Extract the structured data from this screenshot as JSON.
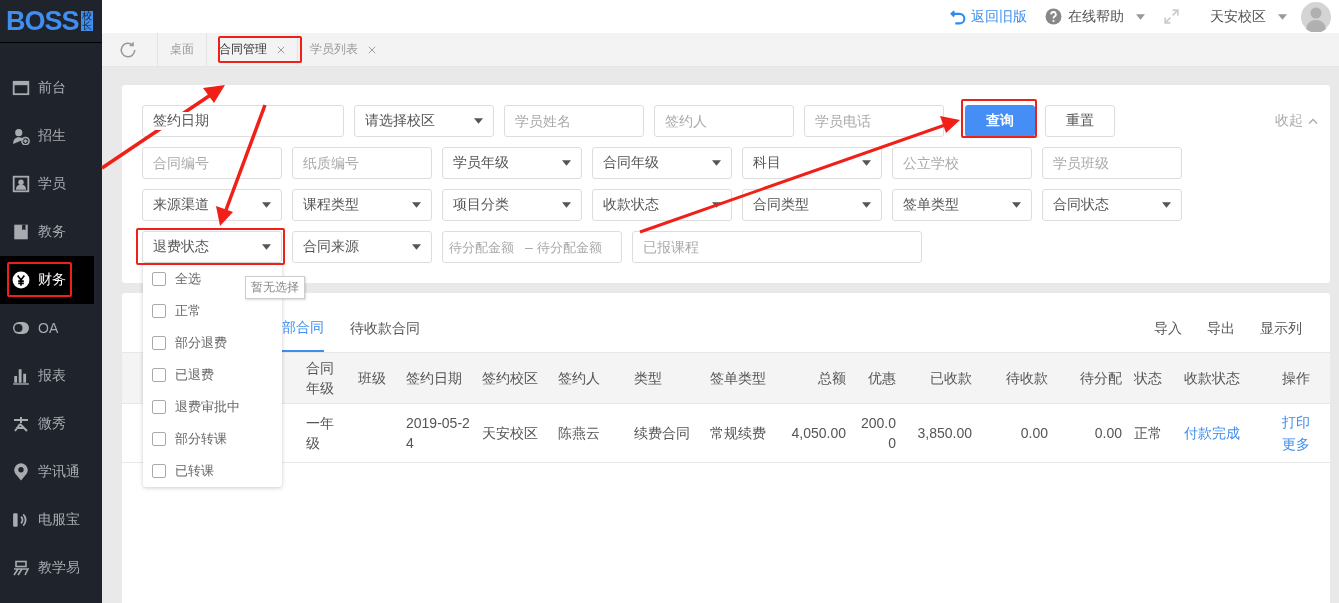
{
  "logo": {
    "text": "BOSS",
    "badge": "校长"
  },
  "header": {
    "back_link": "返回旧版",
    "help": "在线帮助",
    "campus": "天安校区"
  },
  "tabs": [
    {
      "label": "桌面",
      "closable": false,
      "selected": false
    },
    {
      "label": "合同管理",
      "closable": true,
      "selected": true
    },
    {
      "label": "学员列表",
      "closable": true,
      "selected": false
    }
  ],
  "sidebar": {
    "items": [
      {
        "label": "前台",
        "selected": false
      },
      {
        "label": "招生",
        "selected": false
      },
      {
        "label": "学员",
        "selected": false
      },
      {
        "label": "教务",
        "selected": false
      },
      {
        "label": "财务",
        "selected": true
      },
      {
        "label": "OA",
        "selected": false
      },
      {
        "label": "报表",
        "selected": false
      },
      {
        "label": "微秀",
        "selected": false
      },
      {
        "label": "学讯通",
        "selected": false
      },
      {
        "label": "电服宝",
        "selected": false
      },
      {
        "label": "教学易",
        "selected": false
      }
    ]
  },
  "filters": {
    "rows": [
      [
        {
          "kind": "date",
          "label": "签约日期"
        },
        {
          "kind": "select",
          "label": "请选择校区"
        },
        {
          "kind": "input",
          "placeholder": "学员姓名"
        },
        {
          "kind": "input",
          "placeholder": "签约人"
        },
        {
          "kind": "input",
          "placeholder": "学员电话"
        }
      ],
      [
        {
          "kind": "input",
          "placeholder": "合同编号"
        },
        {
          "kind": "input",
          "placeholder": "纸质编号"
        },
        {
          "kind": "select",
          "label": "学员年级"
        },
        {
          "kind": "select",
          "label": "合同年级"
        },
        {
          "kind": "select",
          "label": "科目"
        },
        {
          "kind": "input",
          "placeholder": "公立学校"
        },
        {
          "kind": "input",
          "placeholder": "学员班级"
        }
      ],
      [
        {
          "kind": "select",
          "label": "来源渠道"
        },
        {
          "kind": "select",
          "label": "课程类型"
        },
        {
          "kind": "select",
          "label": "项目分类"
        },
        {
          "kind": "select",
          "label": "收款状态"
        },
        {
          "kind": "select",
          "label": "合同类型"
        },
        {
          "kind": "select",
          "label": "签单类型"
        },
        {
          "kind": "select",
          "label": "合同状态"
        }
      ],
      [
        {
          "kind": "select",
          "label": "退费状态"
        },
        {
          "kind": "select",
          "label": "合同来源"
        },
        {
          "kind": "range",
          "placeholders": [
            "待分配金额",
            "待分配金额"
          ],
          "separator": "–"
        },
        {
          "kind": "wide-input",
          "placeholder": "已报课程"
        }
      ]
    ],
    "query_button": "查询",
    "reset_button": "重置",
    "collapse_link": "收起"
  },
  "dropdown": {
    "options": [
      {
        "label": "全选",
        "checked": false
      },
      {
        "label": "正常",
        "checked": false
      },
      {
        "label": "部分退费",
        "checked": false
      },
      {
        "label": "已退费",
        "checked": false
      },
      {
        "label": "退费审批中",
        "checked": false
      },
      {
        "label": "部分转课",
        "checked": false
      },
      {
        "label": "已转课",
        "checked": false
      }
    ],
    "tooltip": "暂无选择"
  },
  "list": {
    "tabs": [
      {
        "label": "部合同",
        "selected": true
      },
      {
        "label": "待收款合同",
        "selected": false
      }
    ],
    "actions": [
      "导入",
      "导出",
      "显示列"
    ],
    "columns": [
      "合同年级",
      "班级",
      "签约日期",
      "签约校区",
      "签约人",
      "类型",
      "签单类型",
      "总额",
      "优惠",
      "已收款",
      "待收款",
      "待分配",
      "状态",
      "收款状态",
      "操作"
    ],
    "rows": [
      {
        "cells": [
          "一年级",
          "",
          "2019-05-24",
          "天安校区",
          "陈燕云",
          "续费合同",
          "常规续费",
          "4,050.00",
          "200.00",
          "3,850.00",
          "0.00",
          "0.00",
          "正常"
        ],
        "payment_status": "付款完成",
        "actions": [
          "打印",
          "更多"
        ]
      }
    ]
  }
}
